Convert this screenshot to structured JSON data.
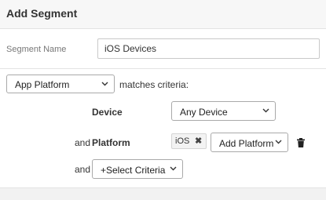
{
  "header": {
    "title": "Add Segment"
  },
  "segment_name": {
    "label": "Segment Name",
    "value": "iOS Devices"
  },
  "criteria": {
    "source_select": "App Platform",
    "matches_text": "matches criteria:",
    "device": {
      "label": "Device",
      "selected": "Any Device"
    },
    "platform": {
      "prefix": "and",
      "label": "Platform",
      "tags": [
        {
          "label": "iOS",
          "remove_glyph": "✖"
        }
      ],
      "add_select": "Add Platform",
      "delete_icon": "trash-icon"
    },
    "add_criteria": {
      "prefix": "and",
      "select": "+Select Criteria"
    }
  }
}
